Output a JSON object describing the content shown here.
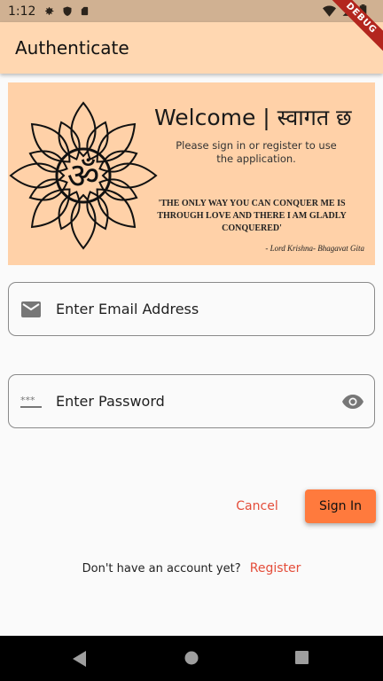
{
  "status_bar": {
    "time": "1:12"
  },
  "app_bar": {
    "title": "Authenticate",
    "debug_label": "DEBUG"
  },
  "banner": {
    "welcome": "Welcome  |  स्वागत छ",
    "instruction": "Please sign in or register to use the application.",
    "quote": "'THE ONLY WAY YOU CAN CONQUER ME IS THROUGH LOVE AND THERE I AM GLADLY CONQUERED'",
    "author": "- Lord Krishna- Bhagavat Gita",
    "symbol": "ॐ"
  },
  "form": {
    "email_placeholder": "Enter Email Address",
    "password_placeholder": "Enter Password"
  },
  "actions": {
    "cancel": "Cancel",
    "sign_in": "Sign In"
  },
  "register": {
    "prompt": "Don't have an account yet?",
    "link": "Register"
  },
  "colors": {
    "accent": "#ff7a3d",
    "link": "#e44d3a",
    "app_bar": "#ffd7b1"
  }
}
